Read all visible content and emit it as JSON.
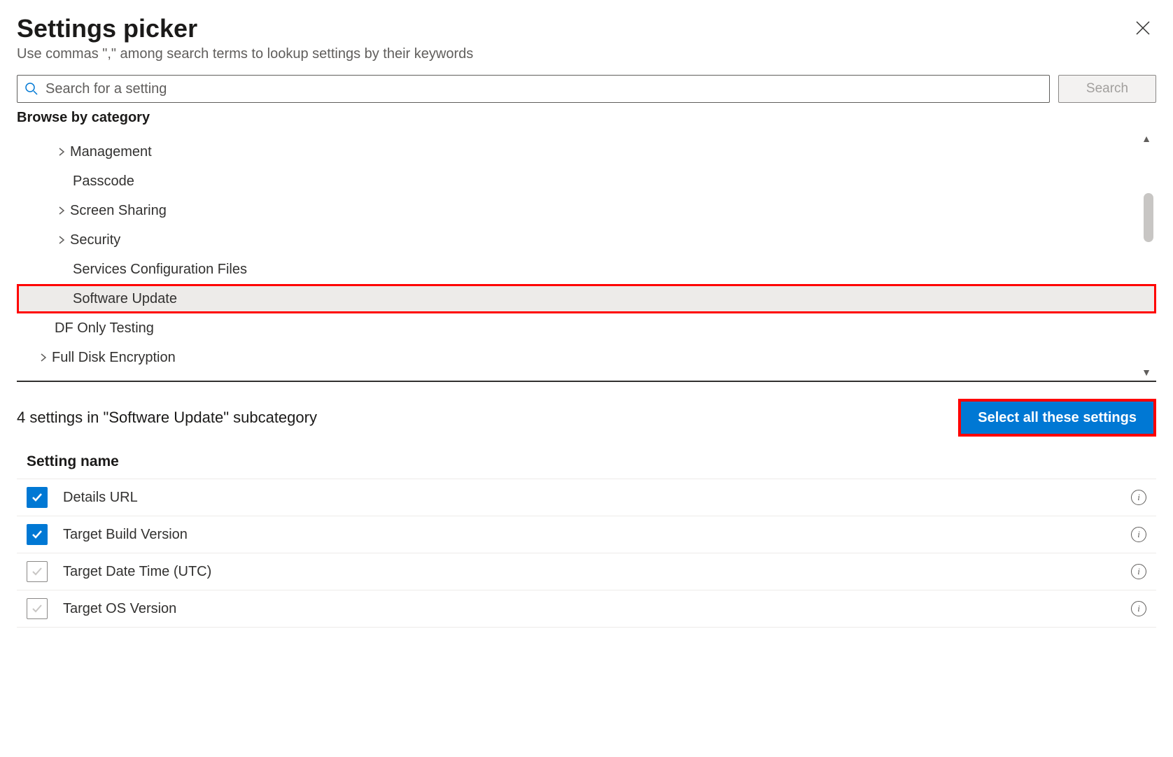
{
  "header": {
    "title": "Settings picker",
    "subtitle": "Use commas \",\" among search terms to lookup settings by their keywords"
  },
  "search": {
    "placeholder": "Search for a setting",
    "button_label": "Search"
  },
  "browse_label": "Browse by category",
  "categories": [
    {
      "label": "Management",
      "expandable": true,
      "level": 1,
      "selected": false
    },
    {
      "label": "Passcode",
      "expandable": false,
      "level": 1,
      "selected": false
    },
    {
      "label": "Screen Sharing",
      "expandable": true,
      "level": 1,
      "selected": false
    },
    {
      "label": "Security",
      "expandable": true,
      "level": 1,
      "selected": false
    },
    {
      "label": "Services Configuration Files",
      "expandable": false,
      "level": 1,
      "selected": false
    },
    {
      "label": "Software Update",
      "expandable": false,
      "level": 1,
      "selected": true
    },
    {
      "label": "DF Only Testing",
      "expandable": false,
      "level": 0,
      "selected": false
    },
    {
      "label": "Full Disk Encryption",
      "expandable": true,
      "level": 0,
      "selected": false
    }
  ],
  "summary": {
    "text": "4 settings in \"Software Update\" subcategory",
    "select_all_label": "Select all these settings"
  },
  "settings_table": {
    "column_header": "Setting name",
    "rows": [
      {
        "name": "Details URL",
        "checked": true
      },
      {
        "name": "Target Build Version",
        "checked": true
      },
      {
        "name": "Target Date Time (UTC)",
        "checked": false
      },
      {
        "name": "Target OS Version",
        "checked": false
      }
    ]
  },
  "colors": {
    "accent": "#0078d4",
    "highlight_border": "#ff0000"
  }
}
